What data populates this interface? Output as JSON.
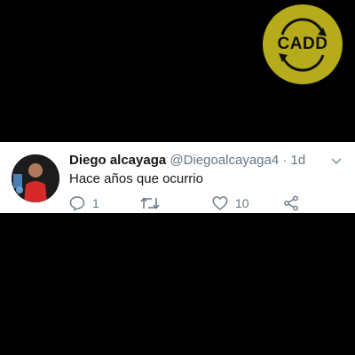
{
  "watermark": {
    "text": "CADD",
    "color": "#b5ab1b"
  },
  "tweet": {
    "name": "Diego alcayaga",
    "handle": "@Diegoalcayaga4",
    "separator": "·",
    "time": "1d",
    "text": "Hace años que ocurrio",
    "replies": "1",
    "retweets": "",
    "likes": "10"
  },
  "icons": [
    "reply-icon",
    "retweet-icon",
    "like-icon",
    "share-icon",
    "chevron-down-icon"
  ]
}
